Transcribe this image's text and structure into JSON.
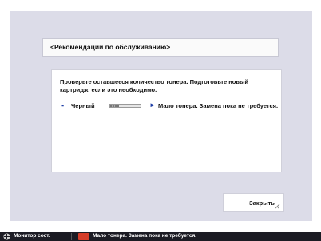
{
  "dialog": {
    "title": "<Рекомендации по обслуживанию>",
    "prompt": "Проверьте оставшееся количество тонера. Подготовьте новый картридж, если это необходимо.",
    "toner_rows": [
      {
        "color_name": "Черный",
        "level_fraction": 0.3,
        "status": "Мало тонера. Замена пока не требуется."
      }
    ],
    "close_label": "Закрыть"
  },
  "status_bar": {
    "monitor_label": "Монитор сост.",
    "message": "Мало тонера. Замена пока не требуется."
  },
  "colors": {
    "panel_bg": "#dcdce8",
    "status_bar_bg": "#1c1c24",
    "accent_blue": "#1e3ea6",
    "warning_red": "#d63e2a"
  },
  "icons": {
    "bullet": "toner-bullet-icon",
    "arrow": "arrow-right-icon",
    "close_corner": "resize-corner-icon",
    "monitor": "status-monitor-icon",
    "warning": "toner-warning-icon"
  }
}
